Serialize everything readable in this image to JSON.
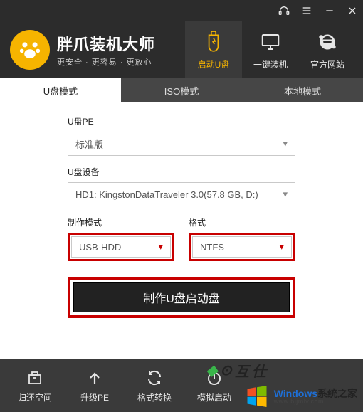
{
  "brand": {
    "title": "胖爪装机大师",
    "sub": "更安全 · 更容易 · 更放心"
  },
  "titlebar_icons": [
    "headset-icon",
    "menu-icon",
    "minimize-icon",
    "close-icon"
  ],
  "main_nav": [
    {
      "label": "启动U盘",
      "icon": "usb-shield-icon",
      "active": true
    },
    {
      "label": "一键装机",
      "icon": "monitor-icon",
      "active": false
    },
    {
      "label": "官方网站",
      "icon": "ie-icon",
      "active": false
    }
  ],
  "tabs": [
    {
      "label": "U盘模式",
      "active": true
    },
    {
      "label": "ISO模式",
      "active": false
    },
    {
      "label": "本地模式",
      "active": false
    }
  ],
  "form": {
    "pe_label": "U盘PE",
    "pe_value": "标准版",
    "device_label": "U盘设备",
    "device_value": "HD1: KingstonDataTraveler 3.0(57.8 GB, D:)",
    "mode_label": "制作模式",
    "mode_value": "USB-HDD",
    "format_label": "格式",
    "format_value": "NTFS",
    "big_button": "制作U盘启动盘"
  },
  "bottom": [
    {
      "label": "归还空间",
      "icon": "box-icon"
    },
    {
      "label": "升级PE",
      "icon": "arrow-up-icon"
    },
    {
      "label": "格式转换",
      "icon": "refresh-icon"
    },
    {
      "label": "模拟启动",
      "icon": "power-icon"
    }
  ],
  "watermark": {
    "brand": "Windows",
    "brand_zh": "系统之家",
    "url": "www.bjjmlv.com"
  },
  "colors": {
    "accent": "#f6b400",
    "highlight": "#c80000",
    "header": "#2c2c2c",
    "body": "#3a3a3a"
  }
}
